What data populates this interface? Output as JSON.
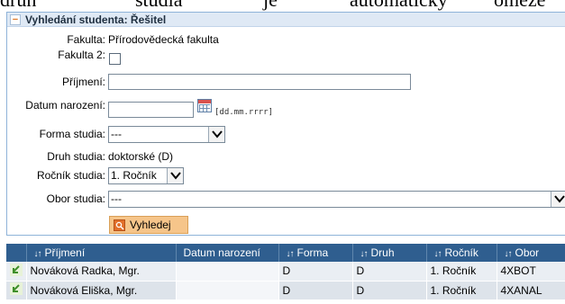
{
  "top_text": [
    "druh",
    "studia",
    "je",
    "automaticky",
    "omeze"
  ],
  "panel": {
    "collapse_symbol": "−",
    "title": "Vyhledání studenta: Řešitel"
  },
  "form": {
    "fakulta_label": "Fakulta:",
    "fakulta_value": "Přírodovědecká fakulta",
    "fakulta2_label": "Fakulta 2:",
    "prijmeni_label": "Příjmení:",
    "prijmeni_value": "",
    "datum_label": "Datum narození:",
    "datum_value": "",
    "date_format_hint": "[dd.mm.rrrr]",
    "forma_label": "Forma studia:",
    "forma_value": "---",
    "druh_label": "Druh studia:",
    "druh_value": "doktorské (D)",
    "rocnik_label": "Ročník studia:",
    "rocnik_value": "1. Ročník",
    "obor_label": "Obor studia:",
    "obor_value": "---",
    "search_button": "Vyhledej"
  },
  "results": {
    "sort_symbol": "↓↑",
    "columns": [
      "Příjmení",
      "Datum narození",
      "Forma",
      "Druh",
      "Ročník",
      "Obor"
    ],
    "sortable": [
      true,
      false,
      true,
      true,
      true,
      true
    ],
    "rows": [
      {
        "name": "Nováková Radka, Mgr.",
        "birth": "",
        "forma": "D",
        "druh": "D",
        "rocnik": "1. Ročník",
        "obor": "4XBOT"
      },
      {
        "name": "Nováková Eliška, Mgr.",
        "birth": "",
        "forma": "D",
        "druh": "D",
        "rocnik": "1. Ročník",
        "obor": "4XANAL"
      }
    ]
  },
  "colors": {
    "header_bg": "#2f5e8f",
    "panel_header_bg": "#dfe9f5",
    "button_bg": "#f6c58a"
  }
}
